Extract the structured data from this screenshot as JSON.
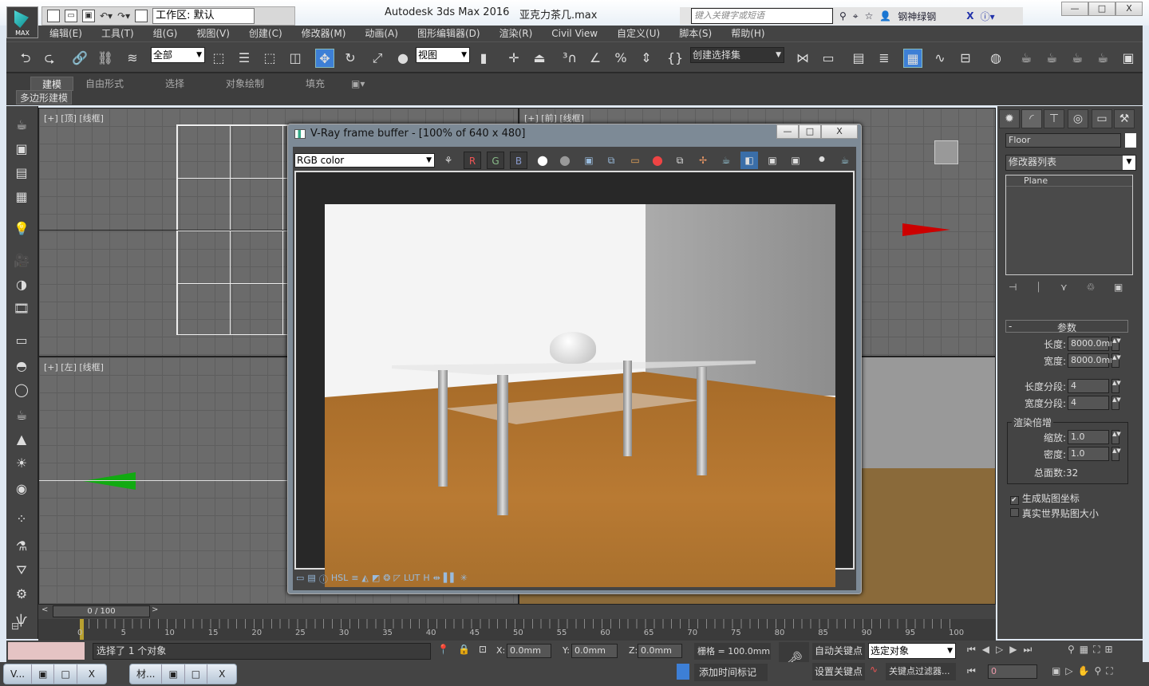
{
  "app": {
    "logo_text": "MAX",
    "title": "Autodesk 3ds Max 2016",
    "file": "亚克力茶几.max",
    "workspace": "工作区: 默认"
  },
  "infocenter": {
    "search_placeholder": "键入关键字或短语",
    "user": "钢神绿钢"
  },
  "window_controls": {
    "minimize": "—",
    "restore": "□",
    "close": "X"
  },
  "menu": [
    "编辑(E)",
    "工具(T)",
    "组(G)",
    "视图(V)",
    "创建(C)",
    "修改器(M)",
    "动画(A)",
    "图形编辑器(D)",
    "渲染(R)",
    "Civil View",
    "自定义(U)",
    "脚本(S)",
    "帮助(H)"
  ],
  "toolbar": {
    "selection_filter": "全部",
    "reference_coord": "视图",
    "named_selection": "创建选择集"
  },
  "ribbon": {
    "tabs": [
      "建模",
      "自由形式",
      "选择",
      "对象绘制",
      "填充"
    ],
    "active": "建模",
    "sub": "多边形建模"
  },
  "viewports": {
    "top": "[+] [顶] [线框]",
    "left": "[+] [左] [线框]",
    "front": "[+] [前] [线框]"
  },
  "vfb": {
    "title": "V-Ray frame buffer - [100% of 640 x 480]",
    "channel": "RGB color",
    "r": "R",
    "g": "G",
    "b": "B"
  },
  "command_panel": {
    "object_name": "Floor",
    "modifier_list": "修改器列表",
    "stack_item": "Plane",
    "rollout": "参数",
    "length_label": "长度:",
    "length": "8000.0mm",
    "width_label": "宽度:",
    "width": "8000.0mm",
    "length_segs_label": "长度分段:",
    "length_segs": "4",
    "width_segs_label": "宽度分段:",
    "width_segs": "4",
    "render_mult": "渲染倍增",
    "scale_label": "缩放:",
    "scale": "1.0",
    "density_label": "密度:",
    "density": "1.0",
    "faces_label": "总面数:",
    "faces": "32",
    "gen_coords": "生成贴图坐标",
    "gen_coords_checked": true,
    "real_world": "真实世界贴图大小",
    "real_world_checked": false
  },
  "timeline": {
    "frame": "0 / 100",
    "ticks": [
      "0",
      "5",
      "10",
      "15",
      "20",
      "25",
      "30",
      "35",
      "40",
      "45",
      "50",
      "55",
      "60",
      "65",
      "70",
      "75",
      "80",
      "85",
      "90",
      "95",
      "100"
    ]
  },
  "status": {
    "message": "选择了 1 个对象",
    "x": "0.0mm",
    "y": "0.0mm",
    "z": "0.0mm",
    "x_label": "X:",
    "y_label": "Y:",
    "z_label": "Z:",
    "grid": "栅格 = 100.0mm",
    "add_time_tag": "添加时间标记",
    "auto_key": "自动关键点",
    "set_key": "设置关键点",
    "key_mode": "选定对象",
    "key_filters": "关键点过滤器...",
    "current_frame": "0"
  },
  "taskbar": [
    {
      "label": "V..."
    },
    {
      "label": "材..."
    }
  ]
}
